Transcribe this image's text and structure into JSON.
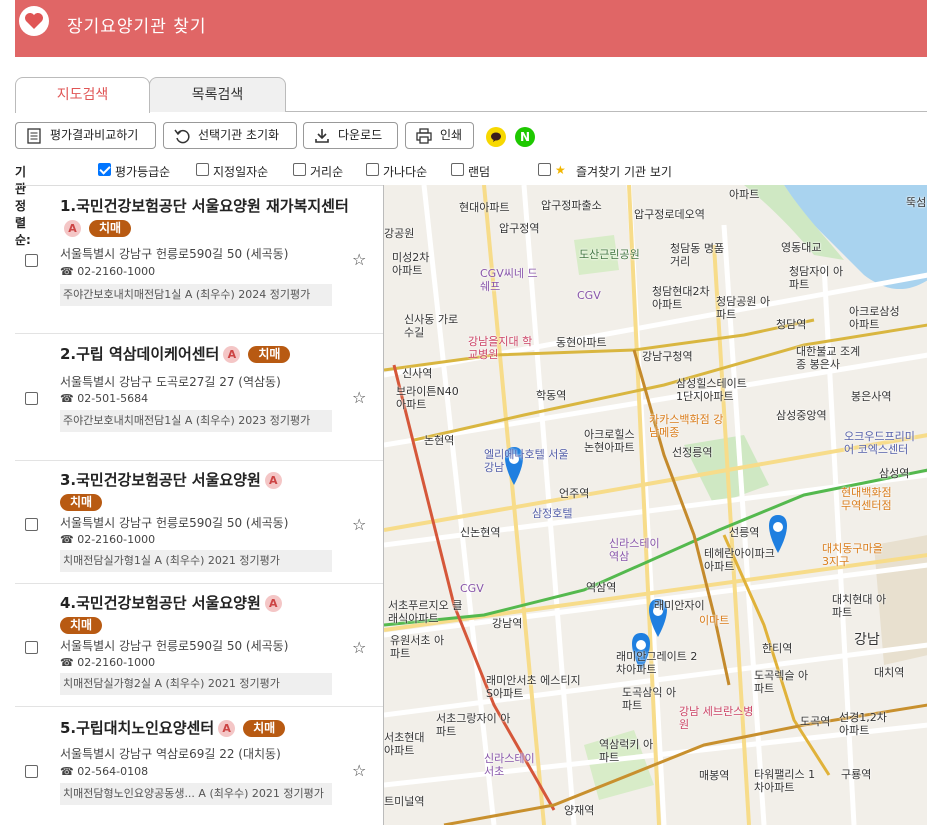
{
  "header": {
    "title": "장기요양기관 찾기"
  },
  "tabs": [
    {
      "label": "지도검색",
      "active": true
    },
    {
      "label": "목록검색",
      "active": false
    }
  ],
  "toolbar": {
    "compare": "평가결과비교하기",
    "reset": "선택기관 초기화",
    "download": "다운로드",
    "print": "인쇄",
    "naver": "N"
  },
  "sort": {
    "label": "기관정렬순:",
    "options": [
      {
        "label": "평가등급순",
        "checked": true
      },
      {
        "label": "지정일자순",
        "checked": false
      },
      {
        "label": "거리순",
        "checked": false
      },
      {
        "label": "가나다순",
        "checked": false
      },
      {
        "label": "랜덤",
        "checked": false
      },
      {
        "label": "즐겨찾기 기관 보기",
        "checked": false
      }
    ]
  },
  "facilities": [
    {
      "name": "1.국민건강보험공단 서울요양원 재가복지센터",
      "grade": "A",
      "badge": "치매",
      "address": "서울특별시 강남구 헌릉로590길 50 (세곡동)",
      "phone": "02-2160-1000",
      "evaluation": "주야간보호내치매전담1실 A (최우수) 2024 정기평가"
    },
    {
      "name": "2.구립 역삼데이케어센터",
      "grade": "A",
      "badge": "치매",
      "address": "서울특별시 강남구 도곡로27길 27 (역삼동)",
      "phone": "02-501-5684",
      "evaluation": "주야간보호내치매전담1실 A (최우수) 2023 정기평가"
    },
    {
      "name": "3.국민건강보험공단 서울요양원",
      "grade": "A",
      "badge": "치매",
      "address": "서울특별시 강남구 헌릉로590길 50 (세곡동)",
      "phone": "02-2160-1000",
      "evaluation": "치매전담실가형1실 A (최우수) 2021 정기평가"
    },
    {
      "name": "4.국민건강보험공단 서울요양원",
      "grade": "A",
      "badge": "치매",
      "address": "서울특별시 강남구 헌릉로590길 50 (세곡동)",
      "phone": "02-2160-1000",
      "evaluation": "치매전담실가형2실 A (최우수) 2021 정기평가"
    },
    {
      "name": "5.구립대치노인요양센터",
      "grade": "A",
      "badge": "치매",
      "address": "서울특별시 강남구 역삼로69길 22 (대치동)",
      "phone": "02-564-0108",
      "evaluation": "치매전담형노인요양공동생... A (최우수) 2021 정기평가"
    }
  ],
  "map": {
    "labels": [
      "아파트",
      "압구정로데오역",
      "현대아파트",
      "압구정역",
      "압구정파출소",
      "영동대교",
      "뚝섬",
      "강공원",
      "미성2차 아파트",
      "CGV씨네 드쉐프",
      "도산근린공원",
      "청담동 명품거리",
      "CGV",
      "청담현대2차 아파트",
      "청담공원 아파트",
      "청담자이 아파트",
      "신사동 가로수길",
      "청담역",
      "아크로삼성 아파트",
      "강남을지대 학교병원",
      "동현아파트",
      "강남구청역",
      "대한불교 조계종 봉은사",
      "신사역",
      "브라이튼N40 아파트",
      "학동역",
      "삼성힐스테이트 1단지아파트",
      "봉은사역",
      "카카스백화점 강남메종",
      "삼성중앙역",
      "논현역",
      "아크로힐스 논현아파트",
      "선정릉역",
      "오크우드프리미어 코엑스센터",
      "엘리에나호텔 서울 강남",
      "언주역",
      "삼성역",
      "현대백화점 무역센터점",
      "삼정호텔",
      "신라스테이 역삼",
      "선릉역",
      "테헤란아이파크 아파트",
      "신논현역",
      "대치동구마을 3지구",
      "CGV",
      "역삼역",
      "서초푸르지오 클래식아파트",
      "래미안자이",
      "이마트",
      "대치현대 아파트",
      "강남역",
      "유원서초 아파트",
      "래미안그레이트 2차아파트",
      "한티역",
      "강남",
      "래미안서초 에스티지S아파트",
      "도곡렉슬 아파트",
      "대치역",
      "도곡삼익 아파트",
      "강남 세브란스병원",
      "서초그랑자이 아파트",
      "도곡역",
      "선경1,2차 아파트",
      "역삼럭키 아파트",
      "서초현대 아파트",
      "신라스테이 서초",
      "매봉역",
      "타워팰리스 1차아파트",
      "구룡역",
      "양재역",
      "트미널역"
    ],
    "pins": 4
  }
}
